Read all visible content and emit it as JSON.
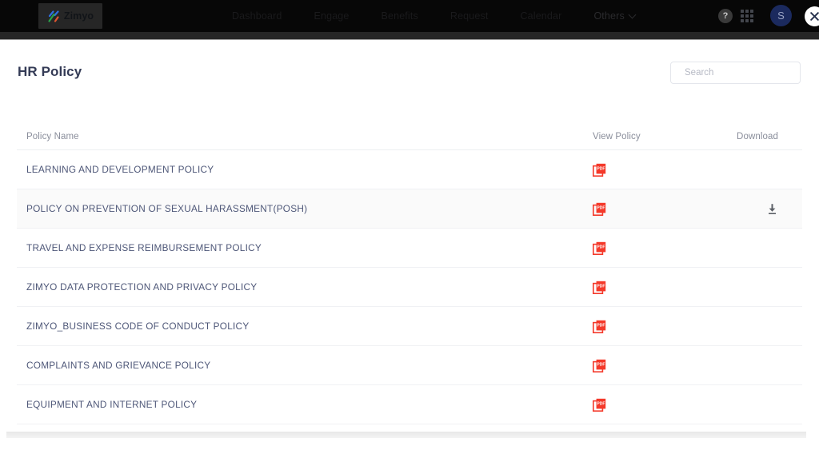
{
  "topnav": {
    "logo": {
      "text": "Zimyo",
      "icon": "zimyo-logo-icon"
    },
    "items": [
      {
        "label": "Dashboard",
        "active": false
      },
      {
        "label": "Engage",
        "active": false
      },
      {
        "label": "Benefits",
        "active": false
      },
      {
        "label": "Request",
        "active": false
      },
      {
        "label": "Calendar",
        "active": false
      },
      {
        "label": "Others",
        "active": true
      }
    ],
    "help_label": "?",
    "grid_icon": "apps-grid-icon",
    "avatar_initial": "S",
    "close_icon": "close-icon"
  },
  "header": {
    "title": "HR Policy"
  },
  "search": {
    "placeholder": "Search",
    "value": "",
    "icon": "search-icon"
  },
  "table": {
    "columns": [
      "Policy Name",
      "View Policy",
      "Download"
    ],
    "rows": [
      {
        "name": "LEARNING AND DEVELOPMENT POLICY",
        "view": "pdf-icon",
        "download": false,
        "hover": false
      },
      {
        "name": "POLICY ON PREVENTION OF SEXUAL HARASSMENT(POSH)",
        "view": "pdf-icon",
        "download": true,
        "hover": true
      },
      {
        "name": "TRAVEL AND EXPENSE REIMBURSEMENT POLICY",
        "view": "pdf-icon",
        "download": false,
        "hover": false
      },
      {
        "name": "ZIMYO DATA PROTECTION AND PRIVACY POLICY",
        "view": "pdf-icon",
        "download": false,
        "hover": false
      },
      {
        "name": "ZIMYO_BUSINESS CODE OF CONDUCT POLICY",
        "view": "pdf-icon",
        "download": false,
        "hover": false
      },
      {
        "name": "COMPLAINTS AND GRIEVANCE POLICY",
        "view": "pdf-icon",
        "download": false,
        "hover": false
      },
      {
        "name": "EQUIPMENT AND INTERNET POLICY",
        "view": "pdf-icon",
        "download": false,
        "hover": false
      }
    ]
  },
  "colors": {
    "navbar_bg": "#070707",
    "title": "#343b56",
    "row_text": "#4e5778",
    "pdf_red": "#f4392a",
    "avatar_bg": "#1b2a5e"
  }
}
